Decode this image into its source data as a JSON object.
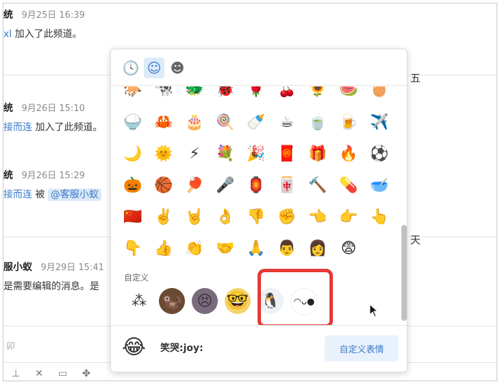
{
  "chat": {
    "messages": [
      {
        "sender": "统",
        "time": "9月25日 16:39",
        "link": "xl",
        "text": "加入了此频道。"
      },
      {
        "sender": "统",
        "time": "9月26日 15:10",
        "link": "接而连",
        "text": "加入了此频道。"
      },
      {
        "sender": "统",
        "time": "9月26日 15:29",
        "link": "接而连",
        "text": "被",
        "tag": "@客服小蚁"
      },
      {
        "sender": "服小蚁",
        "time": "9月29日 15:41",
        "text": "是需要编辑的消息。是"
      }
    ],
    "side_chars": [
      "五",
      "天"
    ],
    "input_placeholder": "卯"
  },
  "picker": {
    "tabs": [
      {
        "name": "recent",
        "icon": "clock-icon",
        "glyph": "🕓",
        "active": false
      },
      {
        "name": "smileys",
        "icon": "smiley-icon",
        "glyph": "☺",
        "active": true
      },
      {
        "name": "custom",
        "icon": "custom-smiley-icon",
        "glyph": "☻",
        "active": false
      }
    ],
    "rows": [
      [
        "🐎",
        "🐄",
        "🐲",
        "🐞",
        "🌹",
        "🍒",
        "🌻",
        "🍉",
        "🥚"
      ],
      [
        "🍚",
        "🦀",
        "🎂",
        "🍭",
        "🍼",
        "☕",
        "🍵",
        "🍺",
        "✈️"
      ],
      [
        "🌙",
        "🌞",
        "⚡",
        "💐",
        "🎉",
        "🧧",
        "🎁",
        "🔥",
        "⚽"
      ],
      [
        "🎃",
        "🏀",
        "🏓",
        "🎤",
        "🏮",
        "🀄",
        "🔨",
        "💊",
        "🥣"
      ],
      [
        "🇨🇳",
        "✌️",
        "🤘",
        "👌",
        "👎",
        "✊",
        "👈",
        "👉",
        "👆"
      ],
      [
        "👇",
        "👍",
        "👏",
        "🤝",
        "🙏",
        "👨",
        "👩",
        "😨"
      ]
    ],
    "custom_label": "自定义",
    "custom_emojis": [
      {
        "name": "graph-sticker",
        "glyph": "⁂"
      },
      {
        "name": "otter-sticker",
        "glyph": "🦦"
      },
      {
        "name": "anime-girl-sticker",
        "glyph": "😣"
      },
      {
        "name": "smart-face-sticker",
        "glyph": "🤓"
      },
      {
        "name": "penguin-sticker",
        "glyph": "🐧"
      },
      {
        "name": "kaomoji-sticker",
        "glyph": "◠ᴗ●"
      }
    ],
    "footer": {
      "preview_glyph": "😂",
      "preview_name": "笑哭:joy:",
      "custom_button": "自定义表情"
    }
  }
}
